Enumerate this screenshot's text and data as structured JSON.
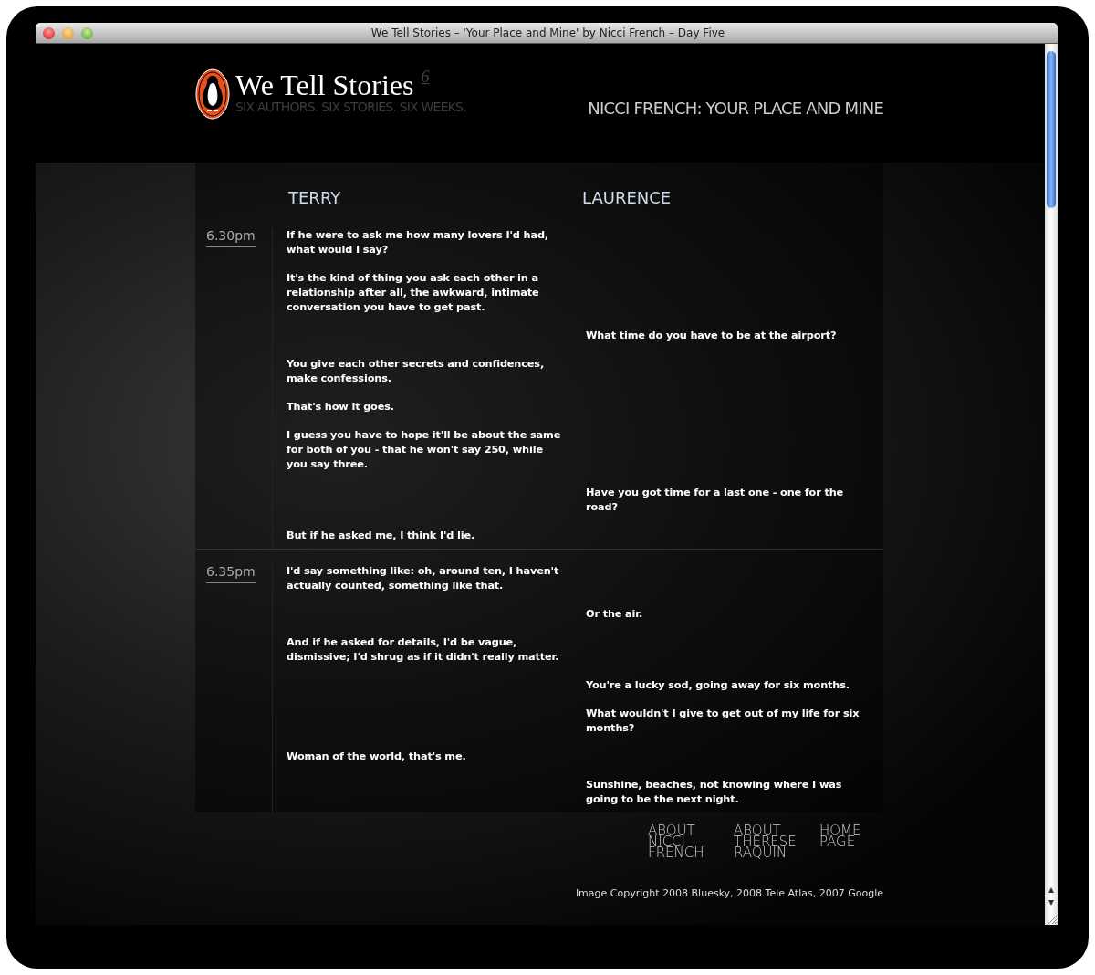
{
  "window": {
    "title": "We Tell Stories – 'Your Place and Mine' by Nicci French – Day Five"
  },
  "header": {
    "logo_title": "We Tell Stories",
    "logo_number": "6",
    "tagline": "SIX AUTHORS. SIX STORIES. SIX WEEKS.",
    "story_title": "NICCI FRENCH: YOUR PLACE AND MINE"
  },
  "columns": [
    {
      "name": "TERRY"
    },
    {
      "name": "LAURENCE"
    }
  ],
  "blocks": [
    {
      "time": "6.30pm",
      "lines": [
        {
          "kind": "left",
          "text": "If he were to ask me how many lovers I'd had, what would I say?"
        },
        {
          "kind": "left",
          "text": "It's the kind of thing you ask each other in a relationship after all, the awkward, intimate conversation you have to get past."
        },
        {
          "kind": "right",
          "text": "What time do you have to be at the airport?"
        },
        {
          "kind": "left",
          "text": "You give each other secrets and confidences, make confessions."
        },
        {
          "kind": "left",
          "text": "That's how it goes."
        },
        {
          "kind": "left",
          "text": "I guess you have to hope it'll be about the same for both of you - that he won't say 250, while you say three."
        },
        {
          "kind": "right",
          "text": "Have you got time for a last one - one for the road?"
        },
        {
          "kind": "left",
          "text": "But if he asked me, I think I'd lie."
        }
      ]
    },
    {
      "time": "6.35pm",
      "lines": [
        {
          "kind": "left",
          "text": "I'd say something like: oh, around ten, I haven't actually counted, something like that."
        },
        {
          "kind": "right",
          "text": "Or the air."
        },
        {
          "kind": "left",
          "text": "And if he asked for details, I'd be vague, dismissive; I'd shrug as if it didn't really matter."
        },
        {
          "kind": "right",
          "text": "You're a lucky sod, going away for six months."
        },
        {
          "kind": "right",
          "text": "What wouldn't I give to get out of my life for six months?"
        },
        {
          "kind": "left",
          "text": "Woman of the world, that's me."
        },
        {
          "kind": "right",
          "text": "Sunshine, beaches, not knowing where I was going to be the next night."
        }
      ]
    }
  ],
  "footer_links": [
    "ABOUT NICCI FRENCH",
    "ABOUT THERESE RAQUIN",
    "HOME PAGE"
  ],
  "copyright": "Image Copyright 2008 Bluesky, 2008 Tele Atlas, 2007 Google"
}
